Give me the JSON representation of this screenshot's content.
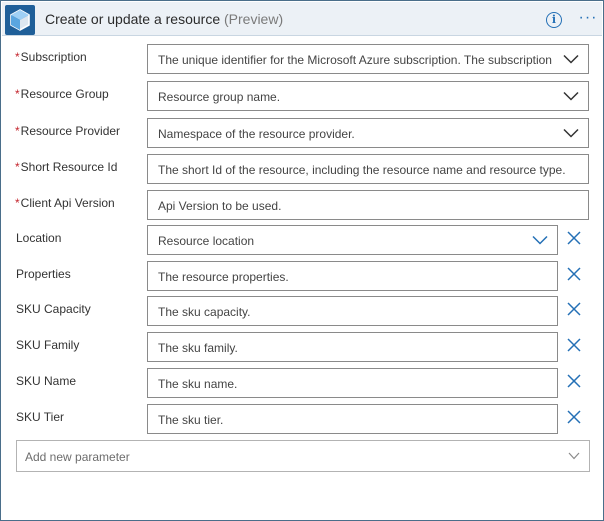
{
  "header": {
    "title": "Create or update a resource",
    "preview": "(Preview)",
    "icons": [
      "azure-cube-icon",
      "info-icon",
      "more-icon"
    ]
  },
  "fields": [
    {
      "label": "Subscription",
      "required": true,
      "placeholder": "The unique identifier for the Microsoft Azure subscription. The subscription",
      "dropdown": true,
      "removable": false
    },
    {
      "label": "Resource Group",
      "required": true,
      "placeholder": "Resource group name.",
      "dropdown": true,
      "removable": false
    },
    {
      "label": "Resource Provider",
      "required": true,
      "placeholder": "Namespace of the resource provider.",
      "dropdown": true,
      "removable": false
    },
    {
      "label": "Short Resource Id",
      "required": true,
      "placeholder": "The short Id of the resource, including the resource name and resource type.",
      "dropdown": false,
      "removable": false
    },
    {
      "label": "Client Api Version",
      "required": true,
      "placeholder": "Api Version to be used.",
      "dropdown": false,
      "removable": false
    },
    {
      "label": "Location",
      "required": false,
      "placeholder": "Resource location",
      "dropdown": true,
      "removable": true
    },
    {
      "label": "Properties",
      "required": false,
      "placeholder": "The resource properties.",
      "dropdown": false,
      "removable": true
    },
    {
      "label": "SKU Capacity",
      "required": false,
      "placeholder": "The sku capacity.",
      "dropdown": false,
      "removable": true
    },
    {
      "label": "SKU Family",
      "required": false,
      "placeholder": "The sku family.",
      "dropdown": false,
      "removable": true
    },
    {
      "label": "SKU Name",
      "required": false,
      "placeholder": "The sku name.",
      "dropdown": false,
      "removable": true
    },
    {
      "label": "SKU Tier",
      "required": false,
      "placeholder": "The sku tier.",
      "dropdown": false,
      "removable": true
    }
  ],
  "add_parameter": {
    "label": "Add new parameter"
  },
  "colors": {
    "accent": "#2470b6",
    "required": "#c4262e",
    "header_bg": "#ecf1f6"
  }
}
